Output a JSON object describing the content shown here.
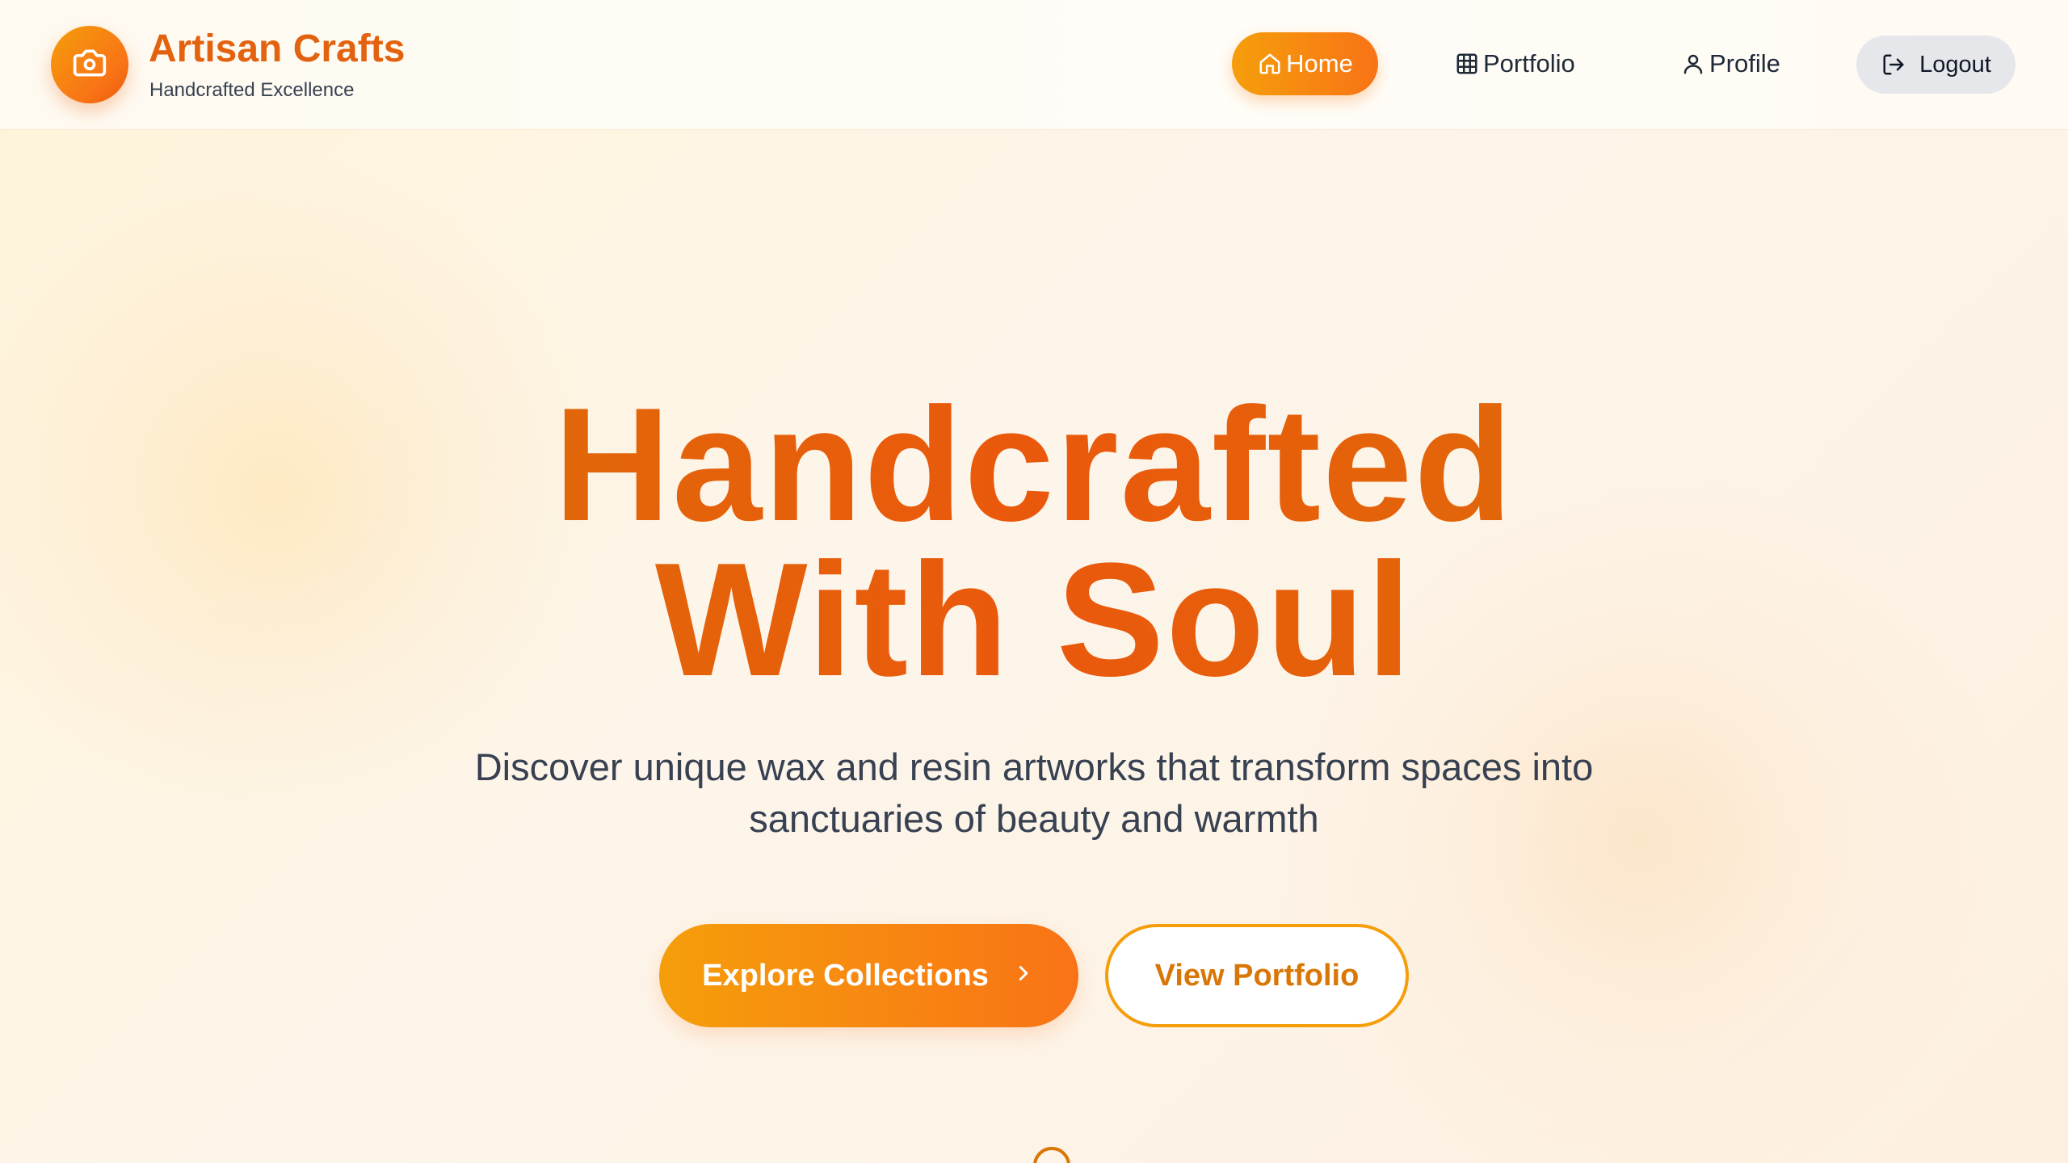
{
  "brand": {
    "title": "Artisan Crafts",
    "subtitle": "Handcrafted Excellence",
    "logo_icon": "camera-icon"
  },
  "nav": {
    "items": [
      {
        "label": "Home",
        "icon": "home-icon",
        "active": true
      },
      {
        "label": "Portfolio",
        "icon": "grid-icon",
        "active": false
      },
      {
        "label": "Profile",
        "icon": "user-icon",
        "active": false
      }
    ],
    "logout_label": "Logout",
    "logout_icon": "logout-icon"
  },
  "hero": {
    "title_line1": "Handcrafted",
    "title_line2": "With Soul",
    "description": "Discover unique wax and resin artworks that transform spaces into sanctuaries of beauty and warmth",
    "primary_cta": "Explore Collections",
    "primary_cta_icon": "chevron-right-icon",
    "secondary_cta": "View Portfolio"
  },
  "colors": {
    "accent_start": "#f59e0b",
    "accent_end": "#f97316",
    "brand_text": "#e2620f",
    "body_text": "#374151"
  }
}
